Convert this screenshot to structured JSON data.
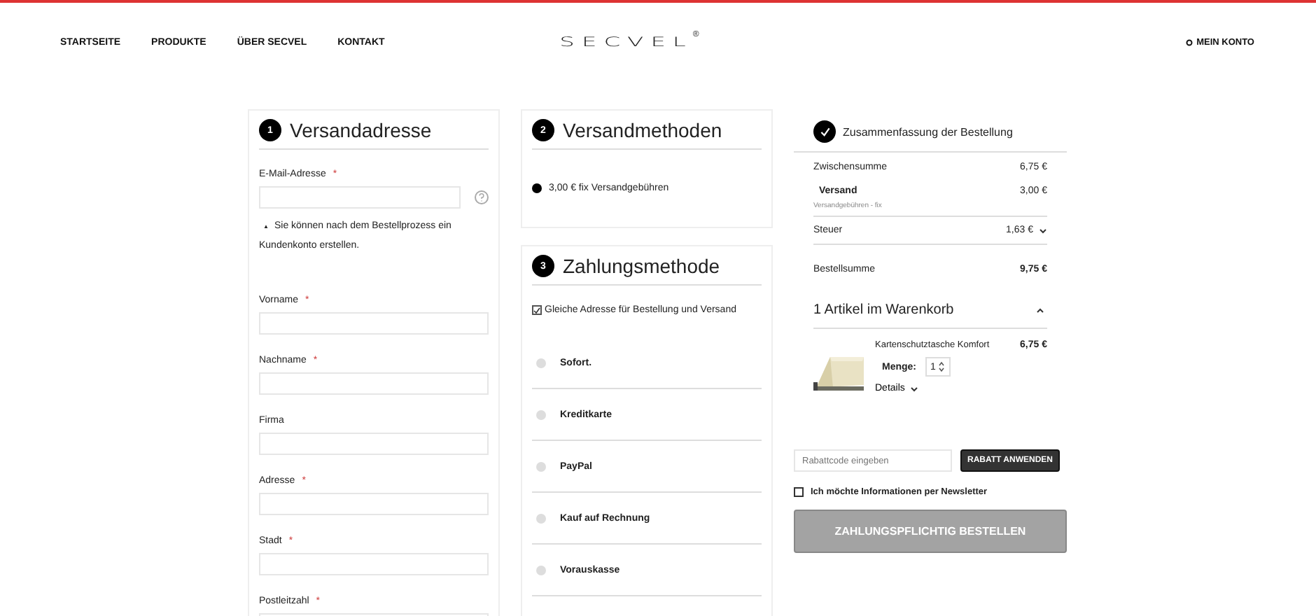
{
  "nav": {
    "links": [
      {
        "label": "STARTSEITE"
      },
      {
        "label": "PRODUKTE"
      },
      {
        "label": "ÜBER SECVEL"
      },
      {
        "label": "KONTAKT"
      }
    ],
    "logo": "SECVEL",
    "logo_mark": "®",
    "account": "MEIN KONTO"
  },
  "shipping_address": {
    "step": "1",
    "title": "Versandadresse",
    "fields": [
      {
        "label": "E-Mail-Adresse",
        "required_mark": "*",
        "help": true,
        "hint": "Sie können nach dem Bestellprozess ein Kundenkonto erstellen.",
        "hint_icon": "▲"
      },
      {
        "label": "Vorname",
        "required_mark": "*"
      },
      {
        "label": "Nachname",
        "required_mark": "*"
      },
      {
        "label": "Firma"
      },
      {
        "label": "Adresse",
        "required_mark": "*"
      },
      {
        "label": "Stadt",
        "required_mark": "*"
      },
      {
        "label": "Postleitzahl",
        "required_mark": "*"
      }
    ]
  },
  "shipping_methods": {
    "step": "2",
    "title": "Versandmethoden",
    "options": [
      {
        "label": "3,00 € fix Versandgebühren",
        "selected": true
      }
    ]
  },
  "payment": {
    "step": "3",
    "title": "Zahlungsmethode",
    "same_address": {
      "label": "Gleiche Adresse für Bestellung und Versand",
      "checked": true
    },
    "methods": [
      {
        "label": "Sofort.",
        "selected": false
      },
      {
        "label": "Kreditkarte",
        "selected": false
      },
      {
        "label": "PayPal",
        "selected": false
      },
      {
        "label": "Kauf auf Rechnung",
        "selected": false
      },
      {
        "label": "Vorauskasse",
        "selected": false
      }
    ]
  },
  "summary": {
    "title": "Zusammenfassung der Bestellung",
    "rows": [
      {
        "kind": "plain",
        "label": "Zwischensumme",
        "value": "6,75 €"
      },
      {
        "kind": "shipping",
        "label": "Versand",
        "value": "3,00 €",
        "note": "Versandgebühren - fix"
      },
      {
        "kind": "expandable",
        "label": "Steuer",
        "value": "1,63 €"
      },
      {
        "kind": "total",
        "label": "Bestellsumme",
        "value": "9,75 €"
      }
    ],
    "cart": {
      "title": "1 Artikel im Warenkorb",
      "expanded": true,
      "items": [
        {
          "name": "Kartenschutztasche Komfort",
          "price": "6,75 €",
          "qty_label": "Menge:",
          "qty": "1",
          "details": "Details"
        }
      ]
    },
    "coupon": {
      "placeholder": "Rabattcode eingeben",
      "button": "RABATT ANWENDEN"
    },
    "newsletter": {
      "label": "Ich möchte Informationen per Newsletter",
      "checked": false
    },
    "order_button": {
      "label": "ZAHLUNGSPFLICHTIG BESTELLEN",
      "disabled": true
    }
  }
}
